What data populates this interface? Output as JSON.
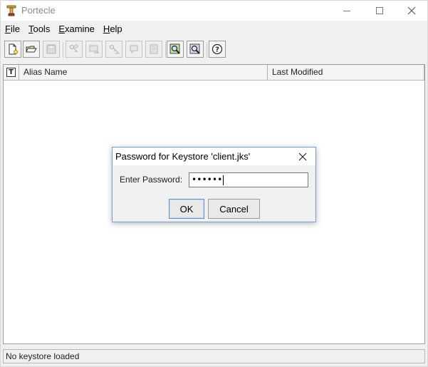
{
  "window": {
    "title": "Portecle"
  },
  "menu": {
    "items": [
      {
        "label": "File",
        "mnemonic": "F",
        "rest": "ile"
      },
      {
        "label": "Tools",
        "mnemonic": "T",
        "rest": "ools"
      },
      {
        "label": "Examine",
        "mnemonic": "E",
        "rest": "xamine"
      },
      {
        "label": "Help",
        "mnemonic": "H",
        "rest": "elp"
      }
    ]
  },
  "toolbar": {
    "buttons": [
      {
        "name": "new-keystore",
        "icon": "new-document-icon",
        "enabled": true
      },
      {
        "name": "open-keystore",
        "icon": "open-folder-icon",
        "enabled": true
      },
      {
        "name": "save-keystore",
        "icon": "save-disk-icon",
        "enabled": false
      },
      {
        "name": "generate-keypair",
        "icon": "keypair-icon",
        "enabled": false
      },
      {
        "name": "import-trusted-cert",
        "icon": "import-cert-icon",
        "enabled": false
      },
      {
        "name": "import-keypair",
        "icon": "import-keypair-icon",
        "enabled": false
      },
      {
        "name": "set-keystore-password",
        "icon": "password-icon",
        "enabled": false
      },
      {
        "name": "keystore-report",
        "icon": "report-icon",
        "enabled": false
      },
      {
        "name": "examine-certificate",
        "icon": "examine-cert-icon",
        "enabled": true
      },
      {
        "name": "examine-ssl",
        "icon": "examine-ssl-icon",
        "enabled": true
      },
      {
        "name": "help",
        "icon": "help-icon",
        "enabled": true
      }
    ]
  },
  "table": {
    "columns": {
      "type": "T",
      "alias": "Alias Name",
      "last_modified": "Last Modified"
    },
    "rows": []
  },
  "status": {
    "text": "No keystore loaded"
  },
  "dialog": {
    "title": "Password for Keystore 'client.jks'",
    "password_label": "Enter Password:",
    "password_masked": "••••••",
    "ok_label": "OK",
    "cancel_label": "Cancel"
  }
}
